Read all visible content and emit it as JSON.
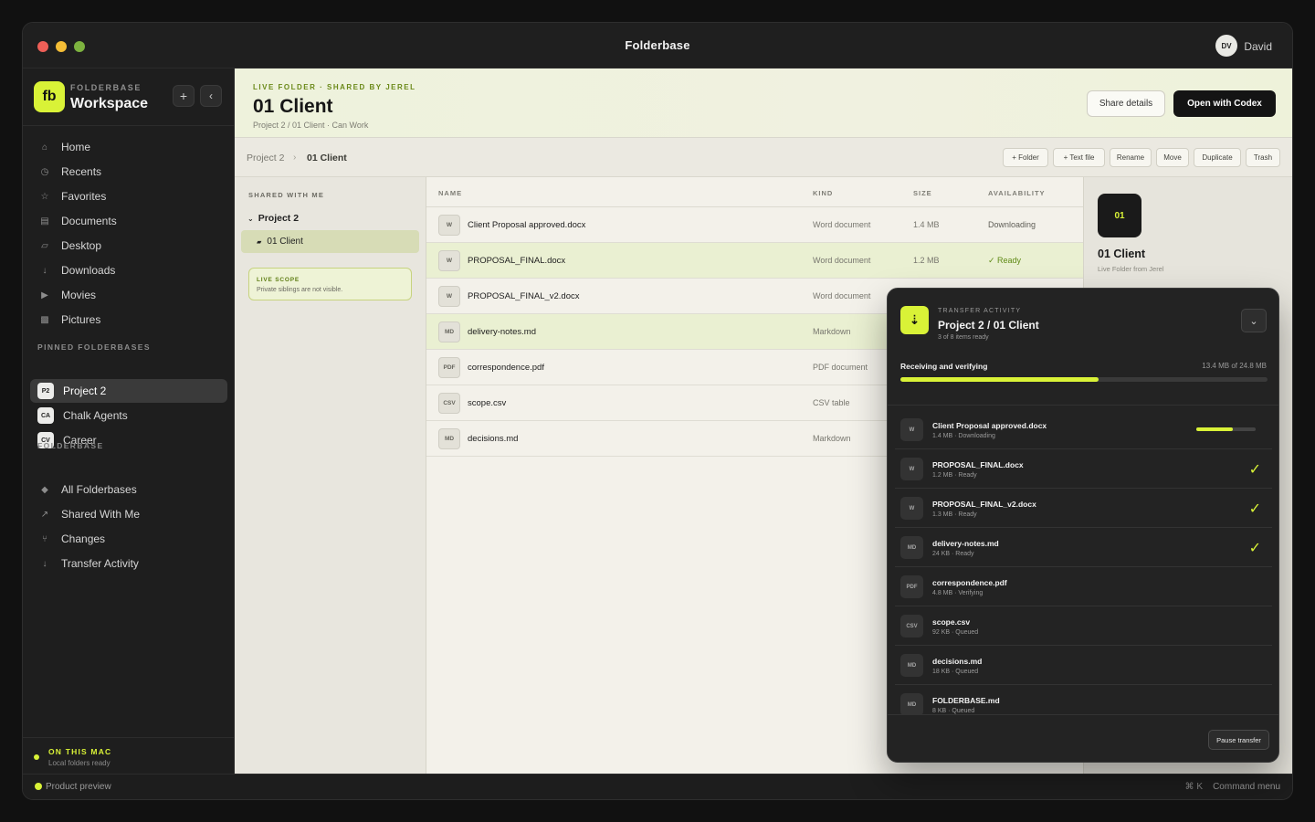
{
  "window": {
    "title": "Folderbase",
    "user_initials": "DV",
    "user_name": "David"
  },
  "sidebar": {
    "logo_text": "fb",
    "kicker": "FOLDERBASE",
    "title": "Workspace",
    "add_icon": "plus-icon",
    "collapse_icon": "chevron-left-icon",
    "nav_items": [
      {
        "label": "Home",
        "icon": "home-icon",
        "glyph": "⌂"
      },
      {
        "label": "Recents",
        "icon": "clock-icon",
        "glyph": "◷"
      },
      {
        "label": "Favorites",
        "icon": "star-icon",
        "glyph": "☆"
      },
      {
        "label": "Documents",
        "icon": "document-icon",
        "glyph": "▤"
      },
      {
        "label": "Desktop",
        "icon": "desktop-icon",
        "glyph": "▱"
      },
      {
        "label": "Downloads",
        "icon": "download-icon",
        "glyph": "↓"
      },
      {
        "label": "Movies",
        "icon": "play-icon",
        "glyph": "▶"
      },
      {
        "label": "Pictures",
        "icon": "image-icon",
        "glyph": "▩"
      }
    ],
    "pinned_heading": "PINNED FOLDERBASES",
    "pinned": [
      {
        "badge": "P2",
        "label": "Project 2",
        "active": true
      },
      {
        "badge": "CA",
        "label": "Chalk Agents",
        "active": false
      },
      {
        "badge": "CV",
        "label": "Career",
        "active": false
      }
    ],
    "folderbase_heading": "FOLDERBASE",
    "folderbase_items": [
      {
        "label": "All Folderbases",
        "icon": "diamond-icon",
        "glyph": "◆"
      },
      {
        "label": "Shared With Me",
        "icon": "arrow-up-right-icon",
        "glyph": "↗"
      },
      {
        "label": "Changes",
        "icon": "branch-icon",
        "glyph": "⑂"
      },
      {
        "label": "Transfer Activity",
        "icon": "arrow-down-icon",
        "glyph": "↓"
      }
    ],
    "footer_title": "ON THIS MAC",
    "footer_sub": "Local folders ready"
  },
  "header": {
    "kicker": "LIVE FOLDER · SHARED BY JEREL",
    "title": "01 Client",
    "subtitle": "Project 2 / 01 Client · Can Work",
    "share_label": "Share details",
    "open_label": "Open with Codex"
  },
  "toolbar": {
    "crumbs": [
      "Project 2",
      "01 Client"
    ],
    "crumb_sep": "›",
    "buttons": [
      "+ Folder",
      "+ Text file",
      "Rename",
      "Move",
      "Duplicate",
      "Trash"
    ]
  },
  "tree": {
    "heading": "SHARED WITH ME",
    "root": "Project 2",
    "child": "01 Client",
    "scope_title": "LIVE SCOPE",
    "scope_sub": "Private siblings are not visible."
  },
  "table": {
    "columns": [
      "NAME",
      "KIND",
      "SIZE",
      "AVAILABILITY"
    ],
    "rows": [
      {
        "icon": "W",
        "name": "Client Proposal approved.docx",
        "kind": "Word document",
        "size": "1.4 MB",
        "availability": "Downloading",
        "selected": false
      },
      {
        "icon": "W",
        "name": "PROPOSAL_FINAL.docx",
        "kind": "Word document",
        "size": "1.2 MB",
        "availability": "✓ Ready",
        "selected": true
      },
      {
        "icon": "W",
        "name": "PROPOSAL_FINAL_v2.docx",
        "kind": "Word document",
        "size": "",
        "availability": "",
        "selected": false
      },
      {
        "icon": "MD",
        "name": "delivery-notes.md",
        "kind": "Markdown",
        "size": "",
        "availability": "",
        "selected": true
      },
      {
        "icon": "PDF",
        "name": "correspondence.pdf",
        "kind": "PDF document",
        "size": "",
        "availability": "",
        "selected": false
      },
      {
        "icon": "CSV",
        "name": "scope.csv",
        "kind": "CSV table",
        "size": "",
        "availability": "",
        "selected": false
      },
      {
        "icon": "MD",
        "name": "decisions.md",
        "kind": "Markdown",
        "size": "",
        "availability": "",
        "selected": false
      }
    ]
  },
  "inspector": {
    "icon_text": "01",
    "name": "01 Client",
    "sub": "Live Folder from Jerel"
  },
  "transfer": {
    "kicker": "TRANSFER ACTIVITY",
    "title": "Project 2 / 01 Client",
    "sub": "3 of 8 items ready",
    "collapse_glyph": "⌄",
    "progress_label": "Receiving and verifying",
    "progress_value": "13.4 MB of 24.8 MB",
    "progress_fraction": 0.54,
    "items": [
      {
        "icon": "W",
        "name": "Client Proposal approved.docx",
        "meta": "1.4 MB · Downloading",
        "state": "downloading",
        "progress": 0.62
      },
      {
        "icon": "W",
        "name": "PROPOSAL_FINAL.docx",
        "meta": "1.2 MB · Ready",
        "state": "ready"
      },
      {
        "icon": "W",
        "name": "PROPOSAL_FINAL_v2.docx",
        "meta": "1.3 MB · Ready",
        "state": "ready"
      },
      {
        "icon": "MD",
        "name": "delivery-notes.md",
        "meta": "24 KB · Ready",
        "state": "ready"
      },
      {
        "icon": "PDF",
        "name": "correspondence.pdf",
        "meta": "4.8 MB · Verifying",
        "state": "verifying"
      },
      {
        "icon": "CSV",
        "name": "scope.csv",
        "meta": "92 KB · Queued",
        "state": "queued"
      },
      {
        "icon": "MD",
        "name": "decisions.md",
        "meta": "18 KB · Queued",
        "state": "queued"
      },
      {
        "icon": "MD",
        "name": "FOLDERBASE.md",
        "meta": "8 KB · Queued",
        "state": "queued"
      }
    ],
    "pause_label": "Pause transfer"
  },
  "statusbar": {
    "left": "Product preview",
    "shortcut": "⌘ K",
    "right": "Command menu"
  },
  "colors": {
    "accent": "#d9f237",
    "sidebar_bg": "#1e1e1e",
    "content_bg": "#f3f1ea",
    "ready_text": "#5f8a16"
  }
}
